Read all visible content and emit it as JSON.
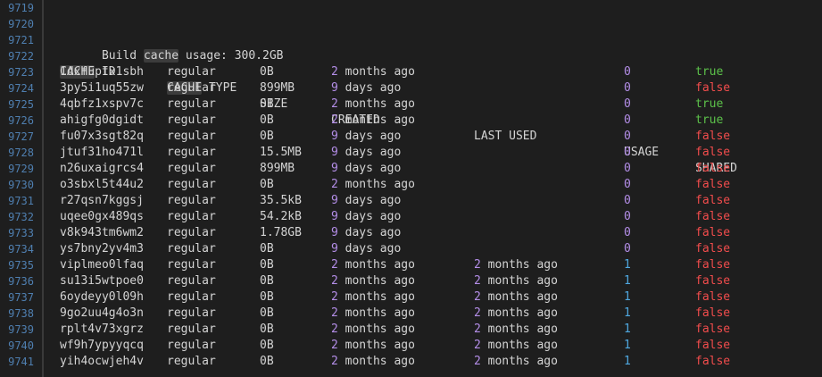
{
  "line_numbers": [
    "9719",
    "9720",
    "9721",
    "9722",
    "9723",
    "9724",
    "9725",
    "9726",
    "9727",
    "9728",
    "9729",
    "9730",
    "9731",
    "9732",
    "9733",
    "9734",
    "9735",
    "9736",
    "9737",
    "9738",
    "9739",
    "9740",
    "9741"
  ],
  "summary": {
    "prefix": "Build ",
    "highlight": "cache",
    "suffix": " usage: 300.2GB"
  },
  "header": {
    "cache_id_hl": "CACHE",
    "cache_id_rest": " ID",
    "cache_type_hl": "CACHE",
    "cache_type_rest": " TYPE",
    "size": "SIZE",
    "created": "CREATED",
    "last_used": "LAST USED",
    "usage": "USAGE",
    "shared": "SHARED"
  },
  "rows": [
    {
      "id": "1dxfuptx1sbh",
      "type": "regular",
      "size": "0B",
      "created_num": "2",
      "created_rest": " months ago",
      "last_num": "",
      "last_rest": "",
      "usage": "0",
      "shared": "true"
    },
    {
      "id": "3py5i1uq55zw",
      "type": "regular",
      "size": "899MB",
      "created_num": "9",
      "created_rest": " days ago",
      "last_num": "",
      "last_rest": "",
      "usage": "0",
      "shared": "false"
    },
    {
      "id": "4qbfz1xspv7c",
      "type": "regular",
      "size": "0B",
      "created_num": "2",
      "created_rest": " months ago",
      "last_num": "",
      "last_rest": "",
      "usage": "0",
      "shared": "true"
    },
    {
      "id": "ahigfg0dgidt",
      "type": "regular",
      "size": "0B",
      "created_num": "2",
      "created_rest": " months ago",
      "last_num": "",
      "last_rest": "",
      "usage": "0",
      "shared": "true"
    },
    {
      "id": "fu07x3sgt82q",
      "type": "regular",
      "size": "0B",
      "created_num": "9",
      "created_rest": " days ago",
      "last_num": "",
      "last_rest": "",
      "usage": "0",
      "shared": "false"
    },
    {
      "id": "jtuf31ho471l",
      "type": "regular",
      "size": "15.5MB",
      "created_num": "9",
      "created_rest": " days ago",
      "last_num": "",
      "last_rest": "",
      "usage": "0",
      "shared": "false"
    },
    {
      "id": "n26uxaigrcs4",
      "type": "regular",
      "size": "899MB",
      "created_num": "9",
      "created_rest": " days ago",
      "last_num": "",
      "last_rest": "",
      "usage": "0",
      "shared": "false"
    },
    {
      "id": "o3sbxl5t44u2",
      "type": "regular",
      "size": "0B",
      "created_num": "2",
      "created_rest": " months ago",
      "last_num": "",
      "last_rest": "",
      "usage": "0",
      "shared": "false"
    },
    {
      "id": "r27qsn7kggsj",
      "type": "regular",
      "size": "35.5kB",
      "created_num": "9",
      "created_rest": " days ago",
      "last_num": "",
      "last_rest": "",
      "usage": "0",
      "shared": "false"
    },
    {
      "id": "uqee0gx489qs",
      "type": "regular",
      "size": "54.2kB",
      "created_num": "9",
      "created_rest": " days ago",
      "last_num": "",
      "last_rest": "",
      "usage": "0",
      "shared": "false"
    },
    {
      "id": "v8k943tm6wm2",
      "type": "regular",
      "size": "1.78GB",
      "created_num": "9",
      "created_rest": " days ago",
      "last_num": "",
      "last_rest": "",
      "usage": "0",
      "shared": "false"
    },
    {
      "id": "ys7bny2yv4m3",
      "type": "regular",
      "size": "0B",
      "created_num": "9",
      "created_rest": " days ago",
      "last_num": "",
      "last_rest": "",
      "usage": "0",
      "shared": "false"
    },
    {
      "id": "viplmeo0lfaq",
      "type": "regular",
      "size": "0B",
      "created_num": "2",
      "created_rest": " months ago",
      "last_num": "2",
      "last_rest": " months ago",
      "usage": "1",
      "shared": "false"
    },
    {
      "id": "su13i5wtpoe0",
      "type": "regular",
      "size": "0B",
      "created_num": "2",
      "created_rest": " months ago",
      "last_num": "2",
      "last_rest": " months ago",
      "usage": "1",
      "shared": "false"
    },
    {
      "id": "6oydeyy0l09h",
      "type": "regular",
      "size": "0B",
      "created_num": "2",
      "created_rest": " months ago",
      "last_num": "2",
      "last_rest": " months ago",
      "usage": "1",
      "shared": "false"
    },
    {
      "id": "9go2uu4g4o3n",
      "type": "regular",
      "size": "0B",
      "created_num": "2",
      "created_rest": " months ago",
      "last_num": "2",
      "last_rest": " months ago",
      "usage": "1",
      "shared": "false"
    },
    {
      "id": "rplt4v73xgrz",
      "type": "regular",
      "size": "0B",
      "created_num": "2",
      "created_rest": " months ago",
      "last_num": "2",
      "last_rest": " months ago",
      "usage": "1",
      "shared": "false"
    },
    {
      "id": "wf9h7ypyyqcq",
      "type": "regular",
      "size": "0B",
      "created_num": "2",
      "created_rest": " months ago",
      "last_num": "2",
      "last_rest": " months ago",
      "usage": "1",
      "shared": "false"
    },
    {
      "id": "yih4ocwjeh4v",
      "type": "regular",
      "size": "0B",
      "created_num": "2",
      "created_rest": " months ago",
      "last_num": "2",
      "last_rest": " months ago",
      "usage": "1",
      "shared": "false"
    }
  ],
  "colors": {
    "background": "#1e1e1e",
    "text": "#d4d4d4",
    "line_number": "#4f7fb0",
    "number_purple": "#b48ee8",
    "usage_one_blue": "#4fa8e0",
    "true_green": "#5cc24a",
    "false_red": "#f14c4c"
  }
}
